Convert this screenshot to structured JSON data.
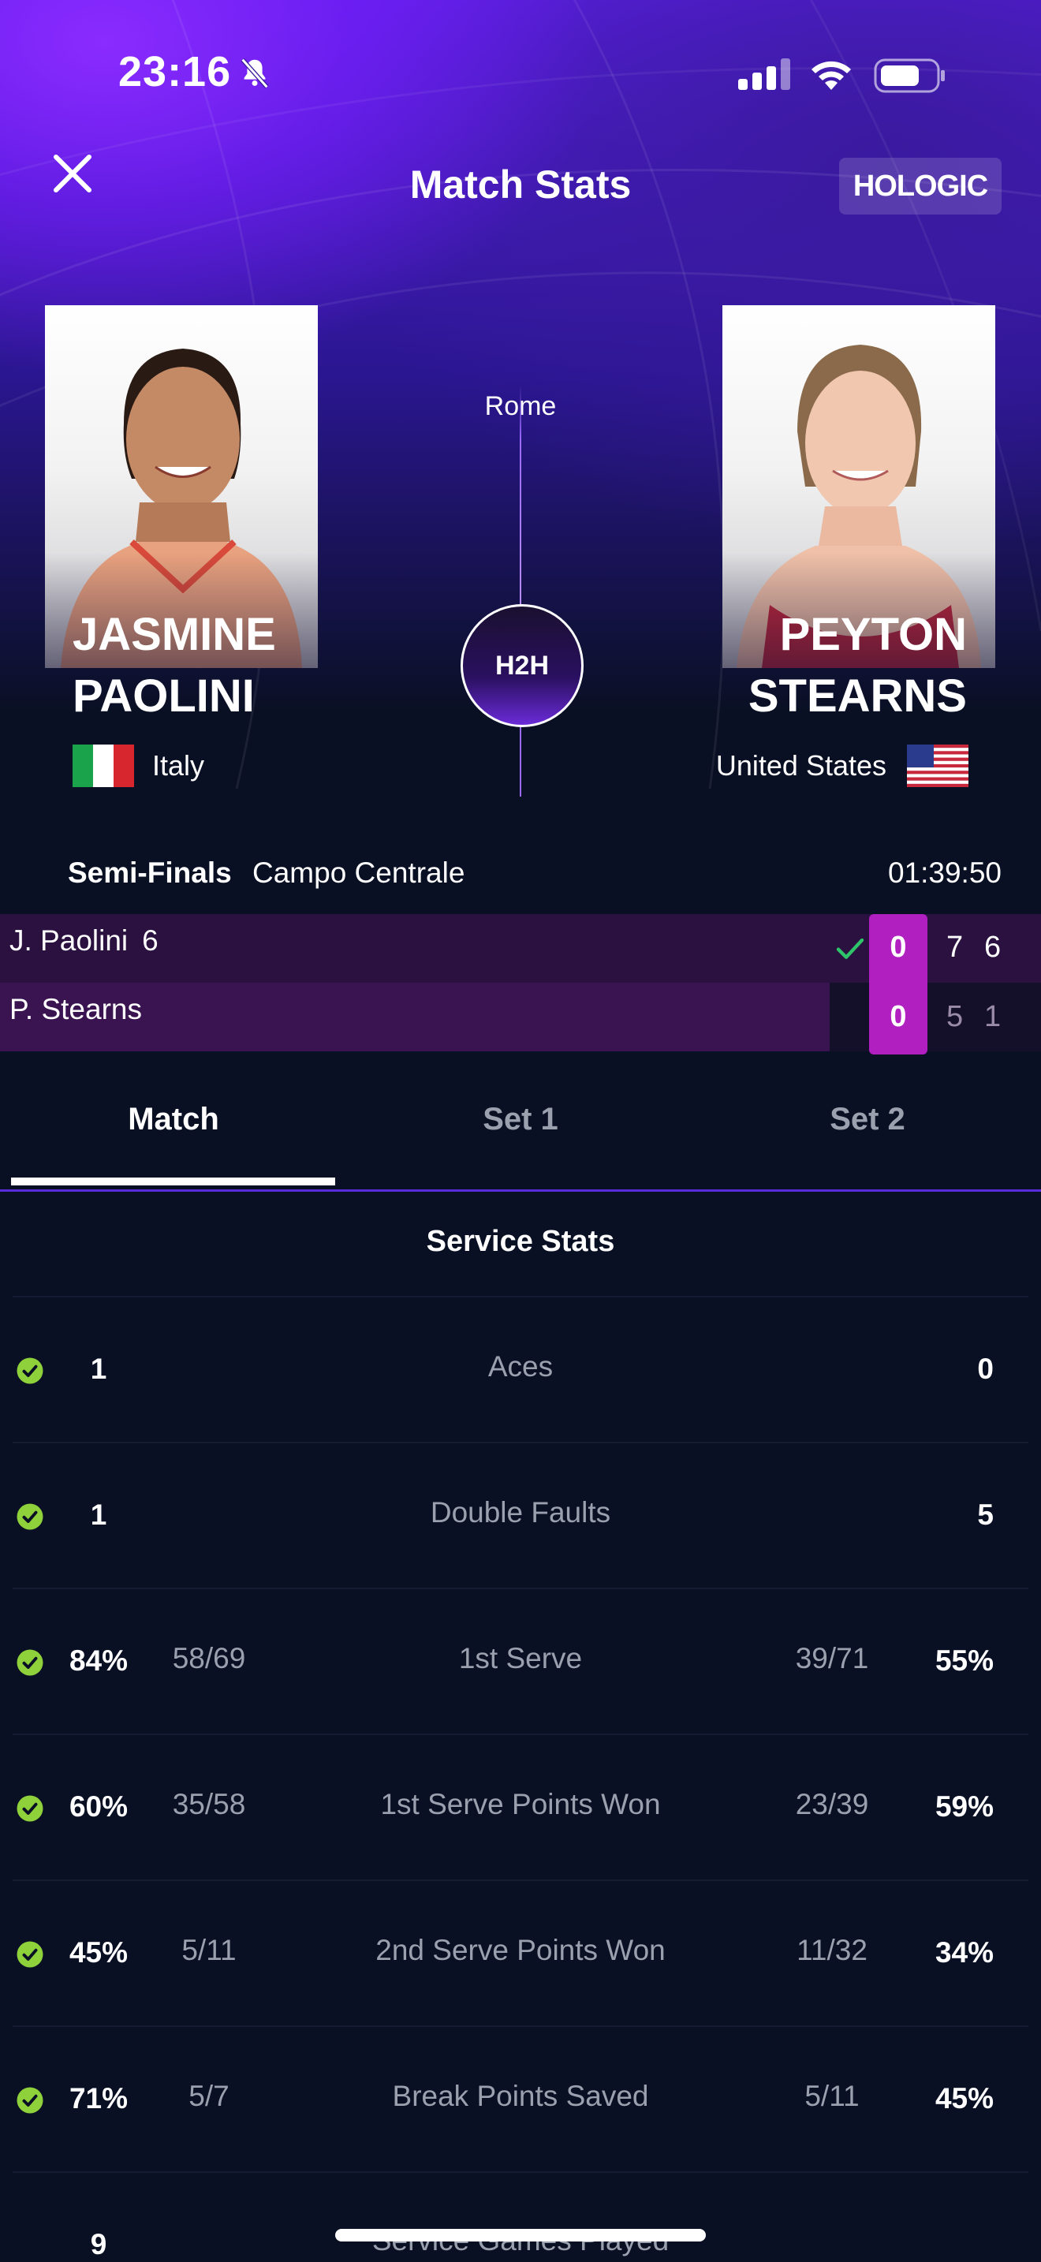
{
  "status_bar": {
    "time": "23:16"
  },
  "header": {
    "title": "Match Stats",
    "sponsor": "HOLOGIC"
  },
  "match": {
    "tournament": "Rome",
    "h2h_label": "H2H",
    "round": "Semi-Finals",
    "court": "Campo Centrale",
    "duration": "01:39:50"
  },
  "players": [
    {
      "first": "Jasmine",
      "last": "Paolini",
      "country": "Italy",
      "short": "J. Paolini",
      "tiebreak_sup": "6",
      "current": "0",
      "sets": [
        "7",
        "6"
      ],
      "winner": true
    },
    {
      "first": "Peyton",
      "last": "Stearns",
      "country": "United States",
      "short": "P. Stearns",
      "current": "0",
      "sets": [
        "5",
        "1"
      ],
      "winner": false
    }
  ],
  "tabs": [
    "Match",
    "Set 1",
    "Set 2"
  ],
  "section": {
    "title": "Service Stats"
  },
  "stats": [
    {
      "label": "Aces",
      "left_value": "1",
      "left_fraction": "",
      "right_fraction": "",
      "right_value": "0",
      "left_better": true
    },
    {
      "label": "Double Faults",
      "left_value": "1",
      "left_fraction": "",
      "right_fraction": "",
      "right_value": "5",
      "left_better": true
    },
    {
      "label": "1st Serve",
      "left_value": "84%",
      "left_fraction": "58/69",
      "right_fraction": "39/71",
      "right_value": "55%",
      "left_better": true
    },
    {
      "label": "1st Serve Points Won",
      "left_value": "60%",
      "left_fraction": "35/58",
      "right_fraction": "23/39",
      "right_value": "59%",
      "left_better": true
    },
    {
      "label": "2nd Serve Points Won",
      "left_value": "45%",
      "left_fraction": "5/11",
      "right_fraction": "11/32",
      "right_value": "34%",
      "left_better": true
    },
    {
      "label": "Break Points Saved",
      "left_value": "71%",
      "left_fraction": "5/7",
      "right_fraction": "5/11",
      "right_value": "45%",
      "left_better": true
    },
    {
      "label": "Service Games Played",
      "left_value": "9",
      "left_fraction": "",
      "right_fraction": "",
      "right_value": "",
      "left_better": false
    }
  ],
  "colors": {
    "accent": "#5a2bd8",
    "win_check": "#8fd13a",
    "current_set_box": "#b21fc0",
    "background": "#0a1024"
  }
}
